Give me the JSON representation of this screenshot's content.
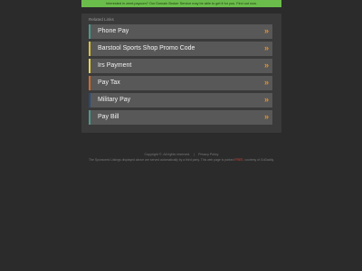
{
  "banner": {
    "text": "Interested in zemt.paycom? Our Domain Broker Service may be able to get it for you. Find out now.",
    "bg_color": "#6bbd4b"
  },
  "panel": {
    "heading": "Related Links",
    "arrow_glyph": "»",
    "links": [
      {
        "label": "Phone Pay",
        "accent": "#4a9a8a"
      },
      {
        "label": "Barstool Sports Shop Promo Code",
        "accent": "#d9c23a"
      },
      {
        "label": "Irs Payment",
        "accent": "#e8d44a"
      },
      {
        "label": "Pay Tax",
        "accent": "#d06a2a"
      },
      {
        "label": "Military Pay",
        "accent": "#2a4a7a"
      },
      {
        "label": "Pay Bill",
        "accent": "#4a9a8a"
      }
    ]
  },
  "footer": {
    "copyright": "Copyright ©. All rights reserved.",
    "separator": "|",
    "privacy_label": "Privacy Policy",
    "parked_prefix": "The Sponsored Listings displayed above are served automatically by a third party. This web page is parked",
    "parked_word": "FREE",
    "parked_suffix": ", courtesy of GoDaddy."
  }
}
